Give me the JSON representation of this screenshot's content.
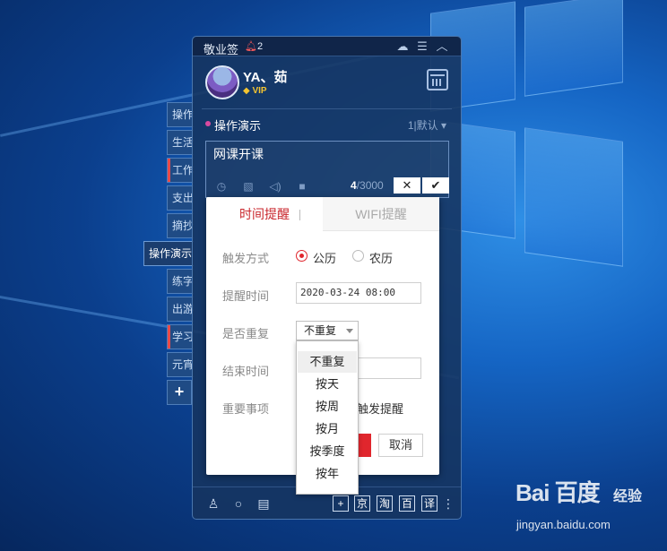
{
  "app": {
    "title": "敬业签",
    "notification_count": "2",
    "user": {
      "name": "YA、茹",
      "badge": "VIP"
    }
  },
  "side_tabs": [
    {
      "label": "操作",
      "active": false
    },
    {
      "label": "生活",
      "active": false
    },
    {
      "label": "工作",
      "active": false
    },
    {
      "label": "支出",
      "active": false
    },
    {
      "label": "摘抄",
      "active": false
    },
    {
      "label": "操作演示",
      "active": true
    },
    {
      "label": "练字",
      "active": false
    },
    {
      "label": "出游",
      "active": false
    },
    {
      "label": "学习",
      "active": false
    },
    {
      "label": "元宵",
      "active": false
    }
  ],
  "add_category_label": "+",
  "category": {
    "title": "操作演示",
    "sort_label": "1|默认"
  },
  "note": {
    "text": "网课开课",
    "count_current": "4",
    "count_max": "/3000",
    "cancel_label": "✕",
    "confirm_label": "✔"
  },
  "reminder_popup": {
    "tabs": {
      "time": "时间提醒",
      "wifi": "WIFI提醒"
    },
    "trigger_label": "触发方式",
    "options": {
      "solar": "公历",
      "lunar": "农历"
    },
    "time_label": "提醒时间",
    "time_value": "2020-03-24 08:00",
    "repeat_label": "是否重复",
    "repeat_value": "不重复",
    "repeat_options": [
      "不重复",
      "按天",
      "按周",
      "按月",
      "按季度",
      "按年"
    ],
    "end_label": "结束时间",
    "important_label": "重要事项",
    "trigger_alert_text": "触发提醒",
    "cancel_label": "取消"
  },
  "bottom_bar": {
    "plus": "+",
    "jd": "京",
    "taobao": "淘",
    "baike": "百",
    "translate": "译"
  },
  "watermark": {
    "logo": "Bai 百度",
    "jingyan": "经验",
    "url": "jingyan.baidu.com"
  },
  "colors": {
    "accent": "#e0262d",
    "panel": "#163460",
    "desktop": "#1565c4"
  }
}
